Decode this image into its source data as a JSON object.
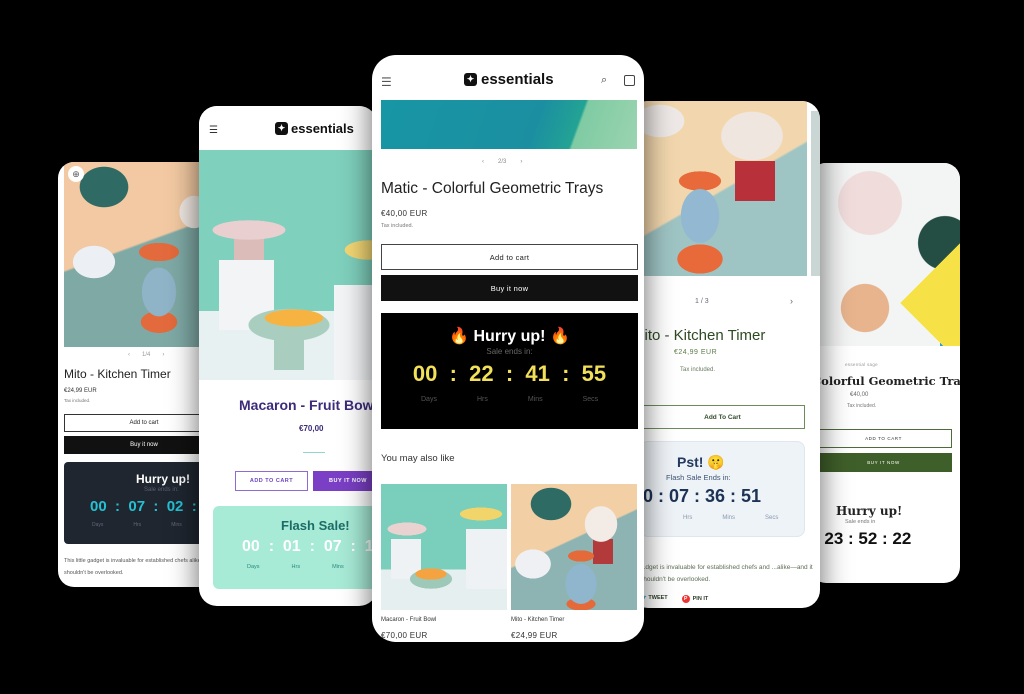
{
  "brand": {
    "logo_text": "essentials",
    "logo_mark": "✦"
  },
  "cards": {
    "kitchen_timer_dark": {
      "pager": {
        "prev": "‹",
        "label": "1/4",
        "next": "›"
      },
      "title": "Mito - Kitchen Timer",
      "price": "€24,99 EUR",
      "tax": "Tax included.",
      "add_to_cart": "Add to cart",
      "buy_now": "Buy it now",
      "timer": {
        "heading": "Hurry up!",
        "subheading": "Sale ends in:",
        "values": "00  :  07  :  02  :",
        "labels": [
          "Days",
          "Hrs",
          "Mins"
        ],
        "color": "#23c1d3"
      },
      "description": "This little gadget is invaluable for established chefs alike—and it shouldn't be overlooked."
    },
    "fruit_bowl": {
      "title": "Macaron - Fruit Bowl",
      "price": "€70,00",
      "add_to_cart": "ADD TO CART",
      "buy_now": "BUY IT NOW",
      "timer": {
        "heading": "Flash Sale!",
        "values": "00  :  01  :  07  :  1",
        "labels": [
          "Days",
          "Hrs",
          "Mins"
        ],
        "color": "#a7ead6"
      },
      "accent_color": "#7a3fc4"
    },
    "geometric_trays_main": {
      "pager": {
        "prev": "‹",
        "label": "2/3",
        "next": "›"
      },
      "title": "Matic - Colorful Geometric Trays",
      "price": "€40,00 EUR",
      "tax": "Tax included.",
      "add_to_cart": "Add to cart",
      "buy_now": "Buy it now",
      "timer": {
        "heading": "🔥 Hurry up! 🔥",
        "subheading": "Sale ends in:",
        "days": "00",
        "hours": "22",
        "minutes": "41",
        "seconds": "55",
        "values": "00  :  22  :  41  :  55",
        "labels": [
          "Days",
          "Hrs",
          "Mins",
          "Secs"
        ],
        "color": "#f2e05a"
      },
      "recommendations": {
        "heading": "You may also like",
        "items": [
          {
            "name": "Macaron - Fruit Bowl",
            "price": "€70,00 EUR"
          },
          {
            "name": "Mito - Kitchen Timer",
            "price": "€24,99 EUR"
          }
        ]
      }
    },
    "kitchen_timer_green": {
      "pager": {
        "label": "1 / 3",
        "next": "›"
      },
      "title": "Mito - Kitchen Timer",
      "price": "€24,99 EUR",
      "tax": "Tax included.",
      "add_to_cart": "Add To Cart",
      "timer": {
        "heading": "Pst! 🤫",
        "subheading": "Flash Sale Ends in:",
        "values": "0 : 07 : 36 : 51",
        "labels": [
          "Hrs",
          "Mins",
          "Secs"
        ],
        "color": "#1d3355"
      },
      "description": "...dget is invaluable for established chefs and ...alike—and it shouldn't be overlooked.",
      "share": {
        "tweet": "TWEET",
        "pin": "PIN IT"
      }
    },
    "geometric_trays_serif": {
      "vendor": "essential sage",
      "title": "Colorful Geometric Trays",
      "price": "€40,00",
      "tax": "Tax included.",
      "add_to_cart": "ADD TO CART",
      "buy_now": "BUY IT NOW",
      "timer": {
        "heading": "Hurry up!",
        "subheading": "Sale ends in",
        "values": ": 23 : 52 : 22"
      },
      "accent_color": "#3f5f2a"
    }
  }
}
